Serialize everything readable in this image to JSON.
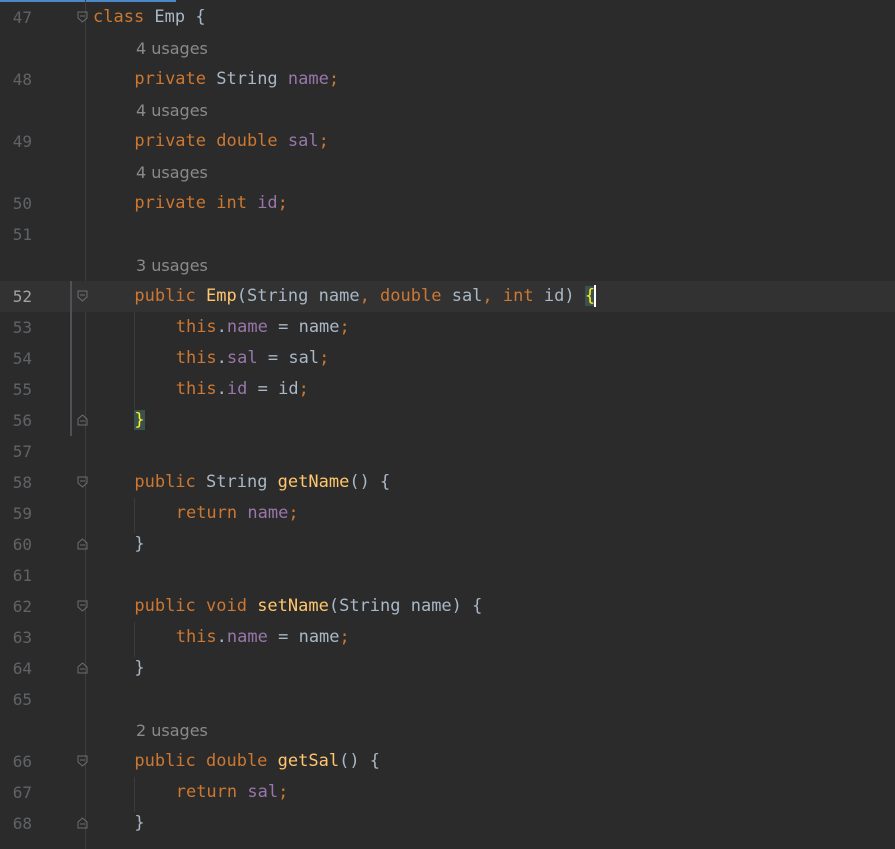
{
  "editor": {
    "lines": [
      {
        "type": "code",
        "num": "47",
        "fold": "open",
        "indent": 0,
        "tokens": [
          {
            "t": "class ",
            "c": "kw"
          },
          {
            "t": "Emp {",
            "c": "plain"
          }
        ]
      },
      {
        "type": "hint",
        "text": "4 usages"
      },
      {
        "type": "code",
        "num": "48",
        "indent": 1,
        "tokens": [
          {
            "t": "private ",
            "c": "kw"
          },
          {
            "t": "String ",
            "c": "plain"
          },
          {
            "t": "name",
            "c": "fld"
          },
          {
            "t": ";",
            "c": "kw"
          }
        ]
      },
      {
        "type": "hint",
        "text": "4 usages"
      },
      {
        "type": "code",
        "num": "49",
        "indent": 1,
        "tokens": [
          {
            "t": "private double ",
            "c": "kw"
          },
          {
            "t": "sal",
            "c": "fld"
          },
          {
            "t": ";",
            "c": "kw"
          }
        ]
      },
      {
        "type": "hint",
        "text": "4 usages"
      },
      {
        "type": "code",
        "num": "50",
        "indent": 1,
        "tokens": [
          {
            "t": "private int ",
            "c": "kw"
          },
          {
            "t": "id",
            "c": "fld"
          },
          {
            "t": ";",
            "c": "kw"
          }
        ]
      },
      {
        "type": "code",
        "num": "51",
        "indent": 0,
        "tokens": []
      },
      {
        "type": "hint",
        "text": "3 usages"
      },
      {
        "type": "code",
        "num": "52",
        "fold": "open",
        "current": true,
        "indent": 1,
        "tokens": [
          {
            "t": "public ",
            "c": "kw"
          },
          {
            "t": "Emp",
            "c": "fn"
          },
          {
            "t": "(String name",
            "c": "plain"
          },
          {
            "t": ", ",
            "c": "kw"
          },
          {
            "t": "double ",
            "c": "kw"
          },
          {
            "t": "sal",
            "c": "plain"
          },
          {
            "t": ", ",
            "c": "kw"
          },
          {
            "t": "int ",
            "c": "kw"
          },
          {
            "t": "id) ",
            "c": "plain"
          },
          {
            "t": "{",
            "c": "brace"
          }
        ]
      },
      {
        "type": "code",
        "num": "53",
        "indent": 2,
        "tokens": [
          {
            "t": "this",
            "c": "kw"
          },
          {
            "t": ".",
            "c": "plain"
          },
          {
            "t": "name",
            "c": "fld"
          },
          {
            "t": " = name",
            "c": "plain"
          },
          {
            "t": ";",
            "c": "kw"
          }
        ]
      },
      {
        "type": "code",
        "num": "54",
        "indent": 2,
        "tokens": [
          {
            "t": "this",
            "c": "kw"
          },
          {
            "t": ".",
            "c": "plain"
          },
          {
            "t": "sal",
            "c": "fld"
          },
          {
            "t": " = sal",
            "c": "plain"
          },
          {
            "t": ";",
            "c": "kw"
          }
        ]
      },
      {
        "type": "code",
        "num": "55",
        "indent": 2,
        "tokens": [
          {
            "t": "this",
            "c": "kw"
          },
          {
            "t": ".",
            "c": "plain"
          },
          {
            "t": "id",
            "c": "fld"
          },
          {
            "t": " = id",
            "c": "plain"
          },
          {
            "t": ";",
            "c": "kw"
          }
        ]
      },
      {
        "type": "code",
        "num": "56",
        "fold": "close",
        "indent": 1,
        "tokens": [
          {
            "t": "}",
            "c": "brace"
          }
        ]
      },
      {
        "type": "code",
        "num": "57",
        "indent": 0,
        "tokens": []
      },
      {
        "type": "code",
        "num": "58",
        "fold": "open",
        "indent": 1,
        "tokens": [
          {
            "t": "public ",
            "c": "kw"
          },
          {
            "t": "String ",
            "c": "plain"
          },
          {
            "t": "getName",
            "c": "fn"
          },
          {
            "t": "() {",
            "c": "plain"
          }
        ]
      },
      {
        "type": "code",
        "num": "59",
        "indent": 2,
        "tokens": [
          {
            "t": "return ",
            "c": "kw"
          },
          {
            "t": "name",
            "c": "fld"
          },
          {
            "t": ";",
            "c": "kw"
          }
        ]
      },
      {
        "type": "code",
        "num": "60",
        "fold": "close",
        "indent": 1,
        "tokens": [
          {
            "t": "}",
            "c": "plain"
          }
        ]
      },
      {
        "type": "code",
        "num": "61",
        "indent": 0,
        "tokens": []
      },
      {
        "type": "code",
        "num": "62",
        "fold": "open",
        "indent": 1,
        "tokens": [
          {
            "t": "public void ",
            "c": "kw"
          },
          {
            "t": "setName",
            "c": "fn"
          },
          {
            "t": "(String name) {",
            "c": "plain"
          }
        ]
      },
      {
        "type": "code",
        "num": "63",
        "indent": 2,
        "tokens": [
          {
            "t": "this",
            "c": "kw"
          },
          {
            "t": ".",
            "c": "plain"
          },
          {
            "t": "name",
            "c": "fld"
          },
          {
            "t": " = name",
            "c": "plain"
          },
          {
            "t": ";",
            "c": "kw"
          }
        ]
      },
      {
        "type": "code",
        "num": "64",
        "fold": "close",
        "indent": 1,
        "tokens": [
          {
            "t": "}",
            "c": "plain"
          }
        ]
      },
      {
        "type": "code",
        "num": "65",
        "indent": 0,
        "tokens": []
      },
      {
        "type": "hint",
        "text": "2 usages"
      },
      {
        "type": "code",
        "num": "66",
        "fold": "open",
        "indent": 1,
        "tokens": [
          {
            "t": "public double ",
            "c": "kw"
          },
          {
            "t": "getSal",
            "c": "fn"
          },
          {
            "t": "() {",
            "c": "plain"
          }
        ]
      },
      {
        "type": "code",
        "num": "67",
        "indent": 2,
        "tokens": [
          {
            "t": "return ",
            "c": "kw"
          },
          {
            "t": "sal",
            "c": "fld"
          },
          {
            "t": ";",
            "c": "kw"
          }
        ]
      },
      {
        "type": "code",
        "num": "68",
        "fold": "close",
        "indent": 1,
        "tokens": [
          {
            "t": "}",
            "c": "plain"
          }
        ]
      }
    ]
  },
  "colors": {
    "background": "#2b2b2b",
    "keyword": "#cc7832",
    "field": "#9876aa",
    "method": "#ffc66d",
    "text": "#a9b7c6",
    "line_number": "#606366",
    "hint": "#8a8a8a",
    "brace_highlight": "#ffef28"
  }
}
